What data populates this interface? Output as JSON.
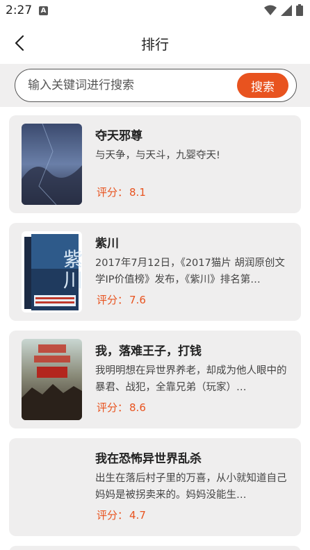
{
  "status": {
    "time": "2:27",
    "notif": "A"
  },
  "header": {
    "title": "排行"
  },
  "search": {
    "placeholder": "输入关键词进行搜索",
    "button": "搜索"
  },
  "score_label": "评分：",
  "books": [
    {
      "title": "夺天邪尊",
      "desc": " 与天争，与天斗，九婴夺天!",
      "score": "8.1"
    },
    {
      "title": "紫川",
      "desc": "2017年7月12日，《2017猫片 胡润原创文学IP价值榜》发布，《紫川》排名第…",
      "score": "7.6"
    },
    {
      "title": "我，落难王子，打钱",
      "desc": "我明明想在异世界养老，却成为他人眼中的暴君、战犯，全靠兄弟（玩家）…",
      "score": "8.6"
    },
    {
      "title": "我在恐怖异世界乱杀",
      "desc": "出生在落后村子里的万喜，从小就知道自己妈妈是被拐卖来的。妈妈没能生…",
      "score": "4.7"
    }
  ],
  "colors": {
    "accent": "#e8531f"
  }
}
